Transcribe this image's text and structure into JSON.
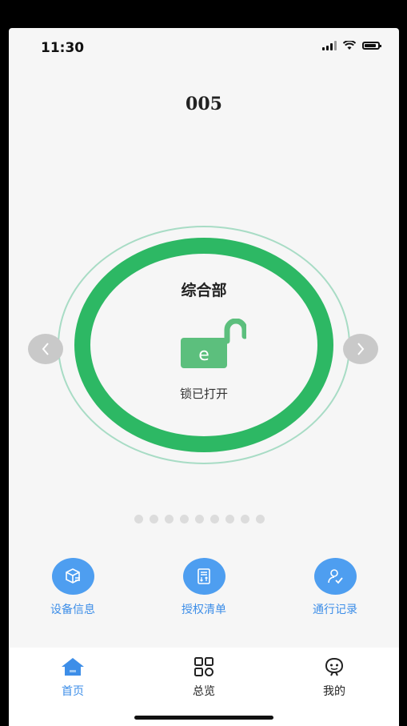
{
  "status_bar": {
    "time": "11:30"
  },
  "device": {
    "id": "005"
  },
  "lock_panel": {
    "department": "综合部",
    "lock_letter": "e",
    "status": "锁已打开",
    "color": "#2db864"
  },
  "pager": {
    "total": 9,
    "current": 1
  },
  "actions": [
    {
      "label": "设备信息",
      "icon": "device-info-icon"
    },
    {
      "label": "授权清单",
      "icon": "authorization-list-icon"
    },
    {
      "label": "通行记录",
      "icon": "access-record-icon"
    }
  ],
  "tabbar": {
    "items": [
      {
        "label": "首页",
        "icon": "home-icon",
        "active": true
      },
      {
        "label": "总览",
        "icon": "grid-icon",
        "active": false
      },
      {
        "label": "我的",
        "icon": "profile-icon",
        "active": false
      }
    ]
  },
  "colors": {
    "accent": "#3d8ee8",
    "action_bg": "#4e9ef0",
    "ring": "#2db864",
    "ring_outer": "#a8dcc5"
  }
}
